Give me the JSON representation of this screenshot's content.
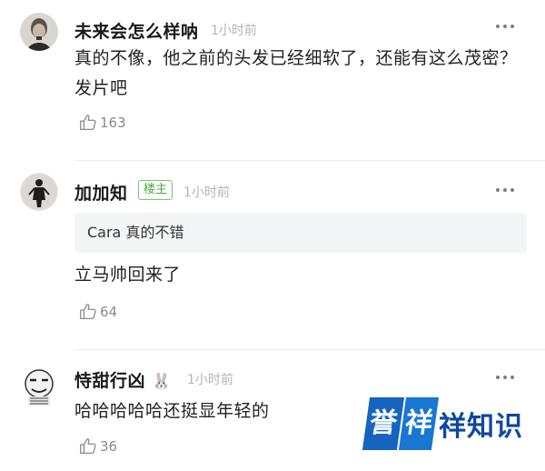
{
  "comments": [
    {
      "username": "未来会怎么样呐",
      "time": "1小时前",
      "text": "真的不像，他之前的头发已经细软了，还能有这么茂密？发片吧",
      "likes": "163"
    },
    {
      "username": "加加知",
      "badge": "楼主",
      "time": "1小时前",
      "quote": "Cara 真的不错",
      "text": "立马帅回来了",
      "likes": "64"
    },
    {
      "username": "恃甜行凶",
      "username_emoji": "🐰",
      "time": "1小时前",
      "text": "哈哈哈哈哈还挺显年轻的",
      "likes": "36"
    }
  ],
  "watermark": {
    "char1": "誉",
    "char2": "祥",
    "rest": "祥知识"
  },
  "colors": {
    "badge_green": "#4aa843",
    "watermark_blue": "#1565c0"
  },
  "icons": {
    "more": "more-dots-icon",
    "like": "thumbs-up-icon"
  }
}
